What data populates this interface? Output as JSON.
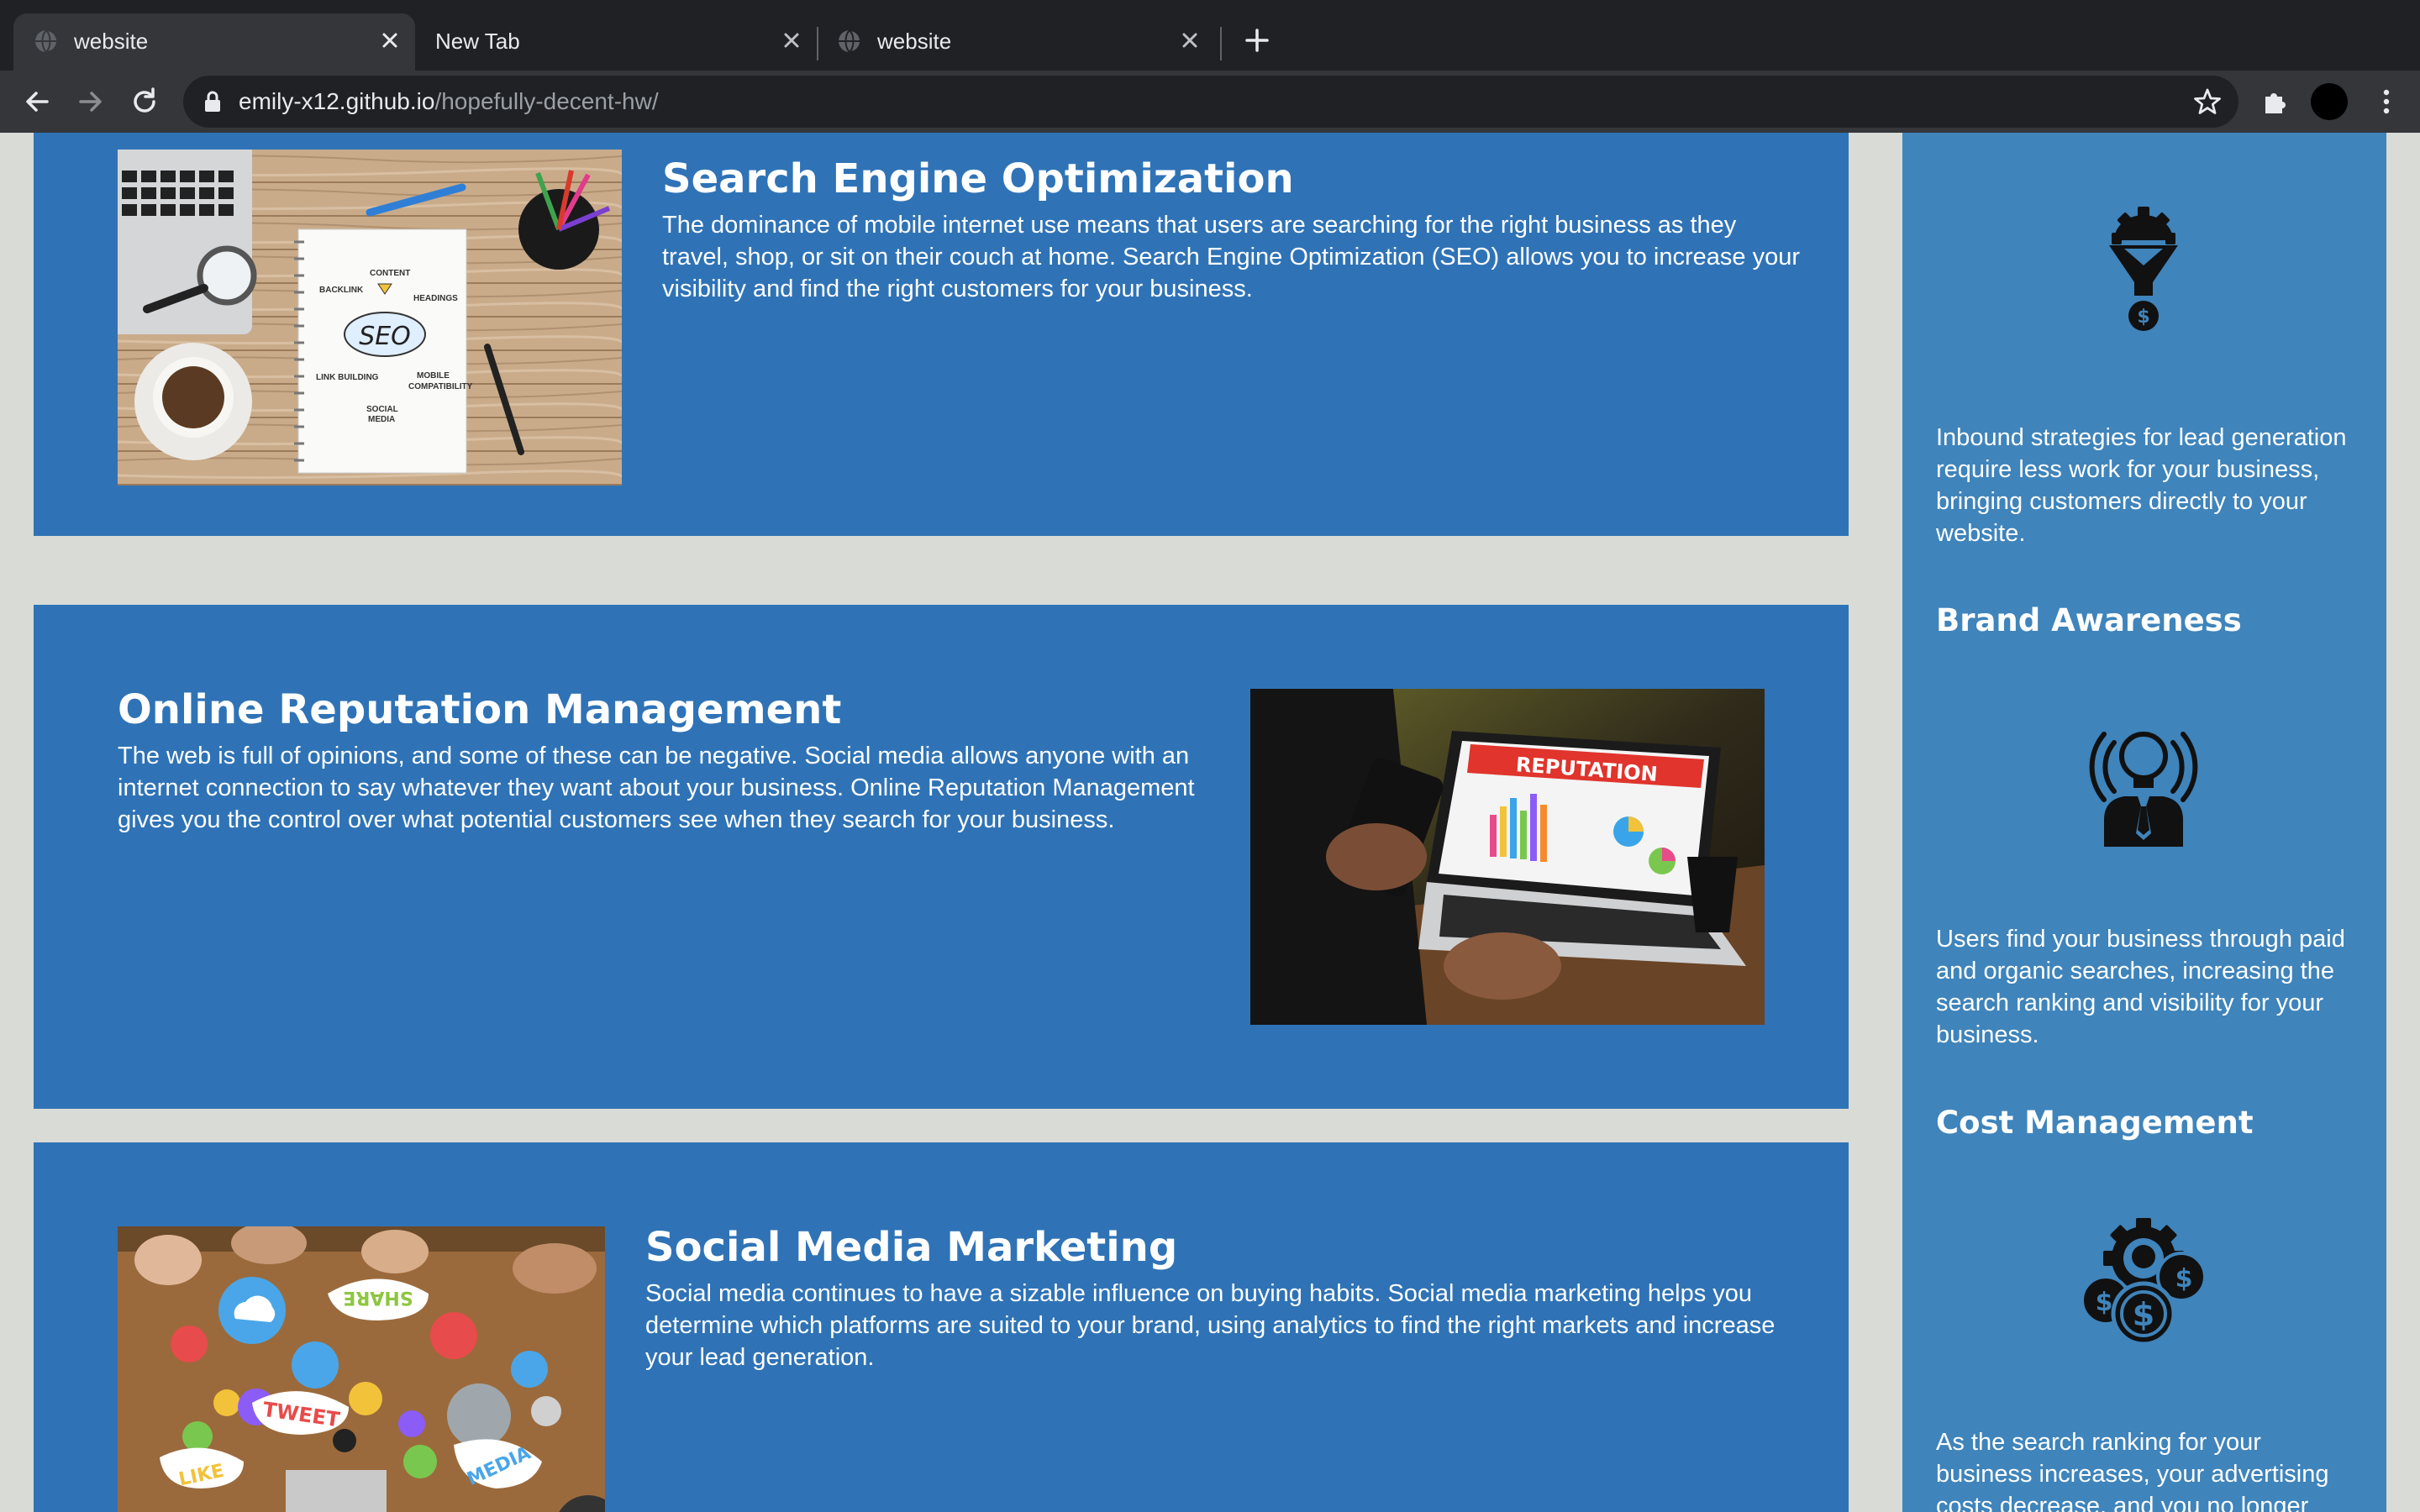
{
  "browser": {
    "tabs": [
      {
        "title": "website",
        "active": true
      },
      {
        "title": "New Tab",
        "active": false
      },
      {
        "title": "website",
        "active": false
      }
    ],
    "url_host": "emily-x12.github.io",
    "url_path": "/hopefully-decent-hw/"
  },
  "sections": [
    {
      "title": "Search Engine Optimization",
      "text": "The dominance of mobile internet use means that users are searching for the right business as they travel, shop, or sit on their couch at home. Search Engine Optimization (SEO) allows you to increase your visibility and find the right customers for your business.",
      "image_labels": {
        "content": "CONTENT",
        "backlink": "BACKLINK",
        "headings": "HEADINGS",
        "seo": "SEO",
        "link_building": "LINK BUILDING",
        "mobile": "MOBILE",
        "compatibility": "COMPATIBILITY",
        "social": "SOCIAL",
        "media": "MEDIA"
      }
    },
    {
      "title": "Online Reputation Management",
      "text": "The web is full of opinions, and some of these can be negative. Social media allows anyone with an internet connection to say whatever they want about your business. Online Reputation Management gives you the control over what potential customers see when they search for your business.",
      "image_labels": {
        "screen_banner": "REPUTATION"
      }
    },
    {
      "title": "Social Media Marketing",
      "text": "Social media continues to have a sizable influence on buying habits. Social media marketing helps you determine which platforms are suited to your brand, using analytics to find the right markets and increase your lead generation.",
      "image_labels": {
        "share": "SHARE",
        "tweet": "TWEET",
        "like": "LIKE",
        "media": "MEDIA"
      }
    }
  ],
  "sidebar": {
    "blocks": [
      {
        "title": "",
        "icon": "funnel-gear-dollar-icon",
        "text": "Inbound strategies for lead generation require less work for your business, bringing customers directly to your website."
      },
      {
        "title": "Brand Awareness",
        "icon": "lightbulb-person-icon",
        "text": "Users find your business through paid and organic searches, increasing the search ranking and visibility for your business."
      },
      {
        "title": "Cost Management",
        "icon": "gear-coins-icon",
        "text": "As the search ranking for your business increases, your advertising costs decrease, and you no longer"
      }
    ]
  },
  "colors": {
    "card_blue": "#2f73b6",
    "sidebar_blue": "#3f84bb",
    "page_bg": "#d9dbd6",
    "chrome_dark": "#202124",
    "chrome_toolbar": "#35363a"
  }
}
